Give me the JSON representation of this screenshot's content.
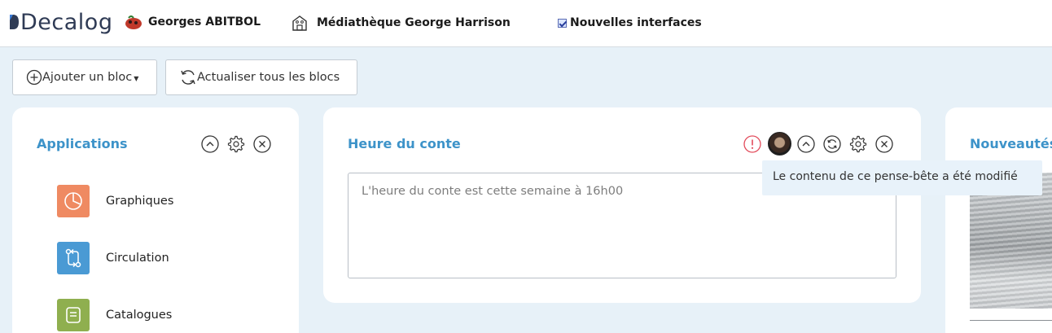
{
  "header": {
    "logo_text": "Decalog",
    "user_name": "Georges ABITBOL",
    "library_name": "Médiathèque George Harrison",
    "new_ui_label": "Nouvelles interfaces",
    "new_ui_checked": true
  },
  "toolbar": {
    "add_block_label": "Ajouter un bloc",
    "refresh_all_label": "Actualiser tous les blocs"
  },
  "applications": {
    "title": "Applications",
    "items": [
      {
        "label": "Graphiques",
        "color": "#ef8a62",
        "icon": "pie-chart-icon"
      },
      {
        "label": "Circulation",
        "color": "#4a9ad4",
        "icon": "circulation-icon"
      },
      {
        "label": "Catalogues",
        "color": "#8faf4f",
        "icon": "catalog-icon"
      }
    ]
  },
  "heure_du_conte": {
    "title": "Heure du conte",
    "textarea_placeholder": "L'heure du conte est cette semaine à 16h00",
    "tooltip": "Le contenu de ce pense-bête a été modifié"
  },
  "nouveautes": {
    "title": "Nouveautés"
  },
  "colors": {
    "accent": "#3d93c9",
    "alert": "#e24a5a",
    "background": "#e7f1f8"
  }
}
